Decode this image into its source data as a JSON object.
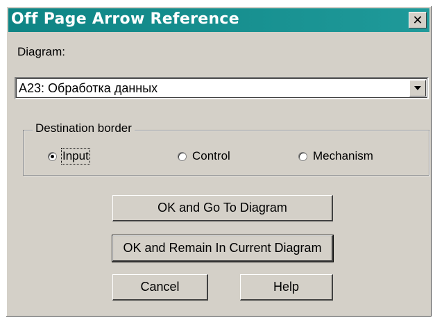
{
  "window": {
    "title": "Off Page Arrow Reference",
    "close_glyph": "✕"
  },
  "diagram": {
    "label": "Diagram:",
    "selected_value": "A23:  Обработка данных"
  },
  "destination": {
    "group_label": "Destination border",
    "options": [
      {
        "label": "Input",
        "checked": true
      },
      {
        "label": "Control",
        "checked": false
      },
      {
        "label": "Mechanism",
        "checked": false
      }
    ]
  },
  "buttons": {
    "ok_go": "OK and Go To Diagram",
    "ok_remain": "OK and Remain In Current Diagram",
    "cancel": "Cancel",
    "help": "Help"
  },
  "colors": {
    "titlebar": "#0e8484",
    "face": "#d4d0c8"
  }
}
